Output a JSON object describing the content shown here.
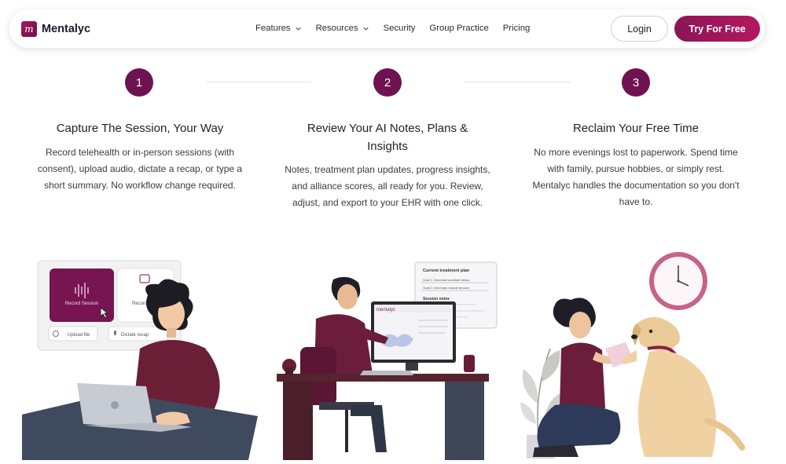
{
  "brand": {
    "name": "Mentalyc",
    "mark": "m"
  },
  "nav": {
    "items": [
      {
        "label": "Features",
        "has_dropdown": true
      },
      {
        "label": "Resources",
        "has_dropdown": true
      },
      {
        "label": "Security",
        "has_dropdown": false
      },
      {
        "label": "Group Practice",
        "has_dropdown": false
      },
      {
        "label": "Pricing",
        "has_dropdown": false
      }
    ],
    "login_label": "Login",
    "cta_label": "Try For Free"
  },
  "colors": {
    "brand": "#6e1250",
    "cta_start": "#8a1556",
    "cta_end": "#b5185f"
  },
  "steps": [
    {
      "number": "1",
      "title": "Capture The Session, Your Way",
      "description": "Record telehealth or in-person sessions (with consent), upload audio, dictate a recap, or type a short summary. No workflow change required."
    },
    {
      "number": "2",
      "title": "Review Your AI Notes, Plans & Insights",
      "description": "Notes, treatment plan updates, progress insights, and alliance scores, all ready for you. Review, adjust, and export to your EHR with one click."
    },
    {
      "number": "3",
      "title": "Reclaim Your Free Time",
      "description": "No more evenings lost to paperwork. Spend time with family, pursue hobbies, or simply rest. Mentalyc handles the documentation so you don't have to."
    }
  ],
  "illustration1": {
    "record_label": "Record Session",
    "record_tele_label": "Record tel",
    "upload_label": "Upload file",
    "dictate_label": "Dictate recap"
  },
  "illustration2": {
    "brand_label": "mentalyc",
    "plan_title": "Current treatment plan",
    "goal1": "Goal 1: Decrease avoidant behav",
    "goal2": "Goal 2: Decrease muscle tension",
    "notes_title": "Session notes"
  }
}
